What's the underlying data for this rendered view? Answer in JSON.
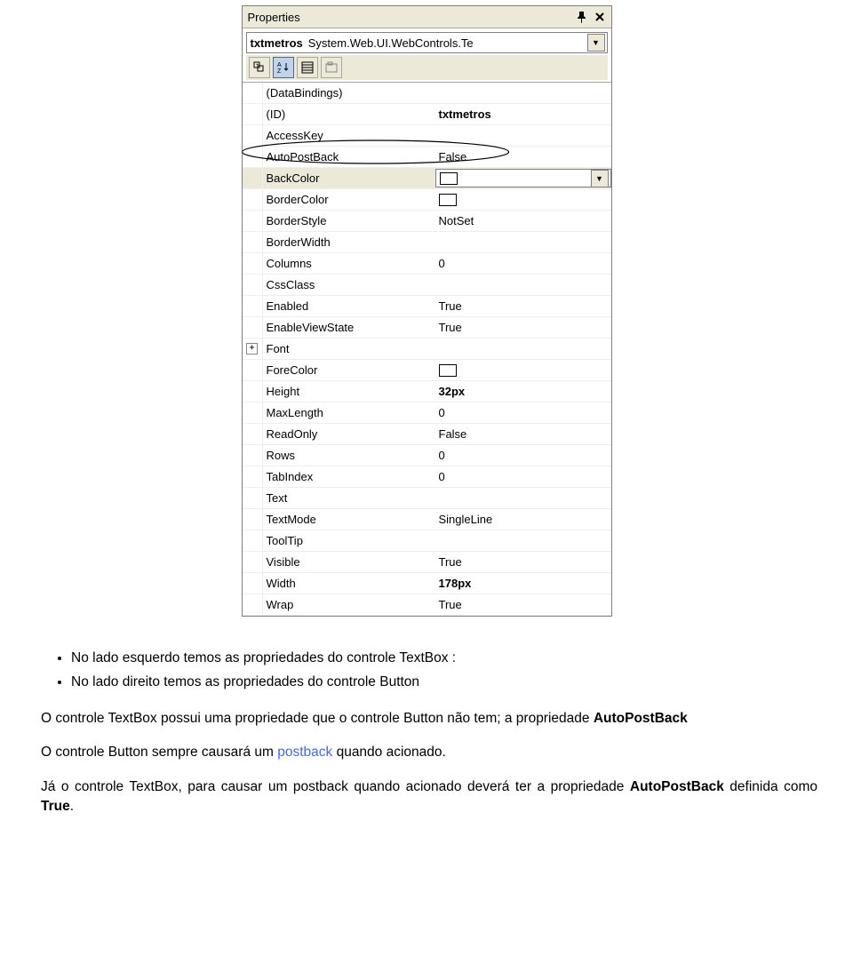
{
  "panel": {
    "title": "Properties",
    "object_name": "txtmetros",
    "object_type": "System.Web.UI.WebControls.Te",
    "toolbar": {
      "btn1": "⊞",
      "btn2": "A↓Z",
      "btn3": "▤",
      "btn4": "▭"
    },
    "props": [
      {
        "name": "(DataBindings)",
        "value": "",
        "swatch": false,
        "bold": false,
        "expand": false,
        "selected": false
      },
      {
        "name": "(ID)",
        "value": "txtmetros",
        "swatch": false,
        "bold": true,
        "expand": false,
        "selected": false
      },
      {
        "name": "AccessKey",
        "value": "",
        "swatch": false,
        "bold": false,
        "expand": false,
        "selected": false
      },
      {
        "name": "AutoPostBack",
        "value": "False",
        "swatch": false,
        "bold": false,
        "expand": false,
        "selected": false
      },
      {
        "name": "BackColor",
        "value": "",
        "swatch": true,
        "bold": false,
        "expand": false,
        "selected": true
      },
      {
        "name": "BorderColor",
        "value": "",
        "swatch": true,
        "bold": false,
        "expand": false,
        "selected": false
      },
      {
        "name": "BorderStyle",
        "value": "NotSet",
        "swatch": false,
        "bold": false,
        "expand": false,
        "selected": false
      },
      {
        "name": "BorderWidth",
        "value": "",
        "swatch": false,
        "bold": false,
        "expand": false,
        "selected": false
      },
      {
        "name": "Columns",
        "value": "0",
        "swatch": false,
        "bold": false,
        "expand": false,
        "selected": false
      },
      {
        "name": "CssClass",
        "value": "",
        "swatch": false,
        "bold": false,
        "expand": false,
        "selected": false
      },
      {
        "name": "Enabled",
        "value": "True",
        "swatch": false,
        "bold": false,
        "expand": false,
        "selected": false
      },
      {
        "name": "EnableViewState",
        "value": "True",
        "swatch": false,
        "bold": false,
        "expand": false,
        "selected": false
      },
      {
        "name": "Font",
        "value": "",
        "swatch": false,
        "bold": false,
        "expand": true,
        "selected": false
      },
      {
        "name": "ForeColor",
        "value": "",
        "swatch": true,
        "bold": false,
        "expand": false,
        "selected": false
      },
      {
        "name": "Height",
        "value": "32px",
        "swatch": false,
        "bold": true,
        "expand": false,
        "selected": false
      },
      {
        "name": "MaxLength",
        "value": "0",
        "swatch": false,
        "bold": false,
        "expand": false,
        "selected": false
      },
      {
        "name": "ReadOnly",
        "value": "False",
        "swatch": false,
        "bold": false,
        "expand": false,
        "selected": false
      },
      {
        "name": "Rows",
        "value": "0",
        "swatch": false,
        "bold": false,
        "expand": false,
        "selected": false
      },
      {
        "name": "TabIndex",
        "value": "0",
        "swatch": false,
        "bold": false,
        "expand": false,
        "selected": false
      },
      {
        "name": "Text",
        "value": "",
        "swatch": false,
        "bold": false,
        "expand": false,
        "selected": false
      },
      {
        "name": "TextMode",
        "value": "SingleLine",
        "swatch": false,
        "bold": false,
        "expand": false,
        "selected": false
      },
      {
        "name": "ToolTip",
        "value": "",
        "swatch": false,
        "bold": false,
        "expand": false,
        "selected": false
      },
      {
        "name": "Visible",
        "value": "True",
        "swatch": false,
        "bold": false,
        "expand": false,
        "selected": false
      },
      {
        "name": "Width",
        "value": "178px",
        "swatch": false,
        "bold": true,
        "expand": false,
        "selected": false
      },
      {
        "name": "Wrap",
        "value": "True",
        "swatch": false,
        "bold": false,
        "expand": false,
        "selected": false
      }
    ]
  },
  "text": {
    "bullet1": "No lado esquerdo temos as propriedades do controle TextBox :",
    "bullet2": "No lado direito temos as propriedades do controle Button",
    "para1a": "O controle TextBox possui uma propriedade que o controle Button não tem; a propriedade ",
    "para1b": "AutoPostBack",
    "para2a": "O controle Button sempre causará um ",
    "para2b": "postback",
    "para2c": " quando acionado.",
    "para3a": "Já o controle TextBox, para causar um postback quando acionado deverá ter a propriedade ",
    "para3b": "AutoPostBack",
    "para3c": " definida como ",
    "para3d": "True",
    "para3e": "."
  }
}
